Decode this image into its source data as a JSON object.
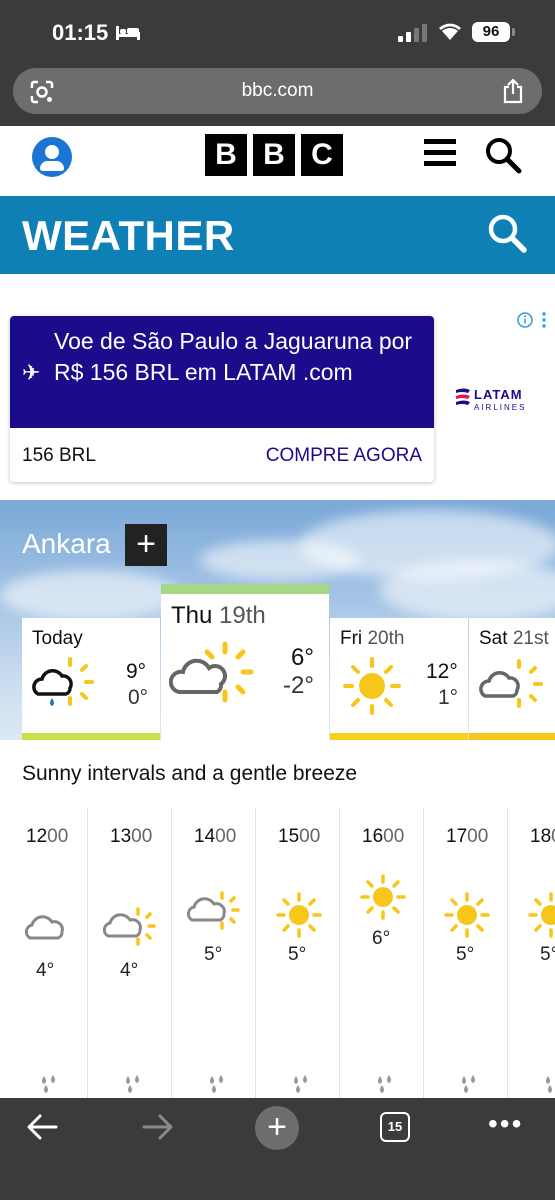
{
  "status_bar": {
    "time": "01:15",
    "battery": "96"
  },
  "browser": {
    "url": "bbc.com",
    "open_tabs": "15",
    "new_tab_label": "+"
  },
  "bbc": {
    "logo_letters": [
      "B",
      "B",
      "C"
    ],
    "section_title": "WEATHER"
  },
  "ad": {
    "headline": "Voe de São Paulo a Jaguaruna por R$ 156 BRL em LATAM .com",
    "price": "156 BRL",
    "cta": "COMPRE AGORA",
    "brand": "LATAM",
    "brand_sub": "AIRLINES",
    "colors": {
      "background": "#1b0c8c",
      "cta": "#1b0c8c"
    }
  },
  "location": {
    "name": "Ankara",
    "add_label": "+"
  },
  "days": [
    {
      "name": "Today",
      "date": "",
      "high": "9°",
      "low": "0°",
      "icon": "light-rain-sunny-intervals-icon",
      "bar_color": "#c8e04a"
    },
    {
      "name": "Thu",
      "date": "19th",
      "high": "6°",
      "low": "-2°",
      "icon": "sunny-intervals-icon",
      "bar_color": "#a6d785"
    },
    {
      "name": "Fri",
      "date": "20th",
      "high": "12°",
      "low": "1°",
      "icon": "sunny-icon",
      "bar_color": "#f7d21b"
    },
    {
      "name": "Sat",
      "date": "21st",
      "high": "",
      "low": "",
      "icon": "sunny-intervals-icon",
      "bar_color": "#f7c61b"
    }
  ],
  "summary": "Sunny intervals and a gentle breeze",
  "hourly": [
    {
      "hour": "12",
      "mins": "00",
      "temp": "4°",
      "icon": "cloud-icon"
    },
    {
      "hour": "13",
      "mins": "00",
      "temp": "4°",
      "icon": "sunny-intervals-icon"
    },
    {
      "hour": "14",
      "mins": "00",
      "temp": "5°",
      "icon": "sunny-intervals-icon"
    },
    {
      "hour": "15",
      "mins": "00",
      "temp": "5°",
      "icon": "sunny-icon"
    },
    {
      "hour": "16",
      "mins": "00",
      "temp": "6°",
      "icon": "sunny-icon"
    },
    {
      "hour": "17",
      "mins": "00",
      "temp": "5°",
      "icon": "sunny-icon"
    },
    {
      "hour": "18",
      "mins": "0",
      "temp": "5°",
      "icon": "sunny-icon"
    }
  ]
}
